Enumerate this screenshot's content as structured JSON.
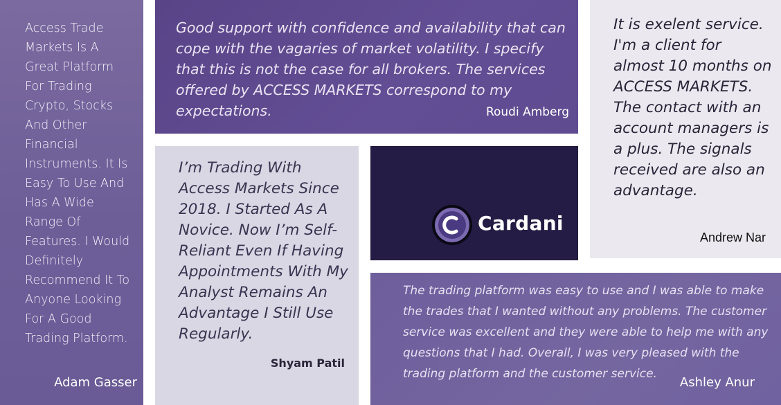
{
  "testimonials": {
    "adam": {
      "quote": "Access Trade Markets Is A Great Platform For Trading Crypto, Stocks And Other Financial Instruments. It Is Easy To Use And Has A Wide Range Of Features. I Would Definitely Recommend It To Anyone Looking For A Good Trading Platform.",
      "author": "Adam Gasser"
    },
    "roudi": {
      "quote": "Good support with confidence and availability that can cope with the vagaries of market volatility. I specify that this is not the case for all brokers. The services offered by ACCESS MARKETS correspond to my expectations.",
      "author": "Roudi Amberg"
    },
    "andrew": {
      "quote": "It is exelent service. I'm a client for almost 10 months on ACCESS MARKETS. The contact with an account managers is a plus. The signals received are also an advantage.",
      "author": "Andrew Nar"
    },
    "shyam": {
      "quote": "I’m Trading With Access Markets Since 2018. I Started As A Novice. Now I’m Self-Reliant Even If Having Appointments With My Analyst Remains An Advantage I Still Use Regularly.",
      "author": "Shyam Patil"
    },
    "ashley": {
      "quote": "The trading platform was easy to use and I was able to make the trades that I wanted without any problems. The customer service was excellent and they were able to help me with any questions that I had. Overall, I was very pleased with the trading platform and the customer service.",
      "author": "Ashley Anur"
    }
  },
  "logo": {
    "text": "Cardani",
    "icon": "cardani-logo-icon",
    "glyph": "C"
  },
  "colors": {
    "brand_dark": "#241c44",
    "purple_primary": "#5f4b90",
    "purple_light": "#7566a0",
    "lavender": "#d9d7e4",
    "light_gray": "#ebe9ef"
  }
}
